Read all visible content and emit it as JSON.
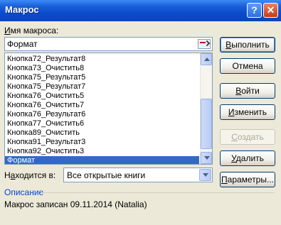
{
  "window": {
    "title": "Макрос",
    "help_glyph": "?",
    "close_glyph": "✕"
  },
  "macro_name": {
    "label_accel": "И",
    "label_rest": "мя макроса:",
    "value": "Формат"
  },
  "macro_list": {
    "items": [
      "Кнопка72_Результат8",
      "Кнопка73_Очистить8",
      "Кнопка75_Результат5",
      "Кнопка75_Результат7",
      "Кнопка76_Очистить5",
      "Кнопка76_Очистить7",
      "Кнопка76_Результат6",
      "Кнопка77_Очистить6",
      "Кнопка89_Очистить",
      "Кнопка91_Результат3",
      "Кнопка92_Очистить3",
      "Формат"
    ],
    "selected": "Формат"
  },
  "location": {
    "label_pre": "Н",
    "label_accel": "а",
    "label_post": "ходится в:",
    "value": "Все открытые книги"
  },
  "buttons": {
    "run": {
      "accel": "В",
      "rest": "ыполнить"
    },
    "cancel": "Отмена",
    "step_into": {
      "accel": "В",
      "rest": "ойти"
    },
    "edit": {
      "accel": "И",
      "rest": "зменить"
    },
    "create": {
      "accel": "С",
      "rest": "оздать"
    },
    "delete": {
      "accel": "У",
      "rest": "далить"
    },
    "options": {
      "accel": "П",
      "rest": "араметры..."
    }
  },
  "description": {
    "section_label": "Описание",
    "text": "Макрос записан  09.11.2014 (Natalia)"
  },
  "colors": {
    "selection": "#316ac5",
    "section_label": "#0046d5",
    "dialog_bg": "#ece9d8"
  },
  "icons": {
    "ref_button": "collapse-dialog-icon",
    "scroll_up": "chevron-up-icon",
    "scroll_down": "chevron-down-icon",
    "dropdown": "chevron-down-icon"
  }
}
